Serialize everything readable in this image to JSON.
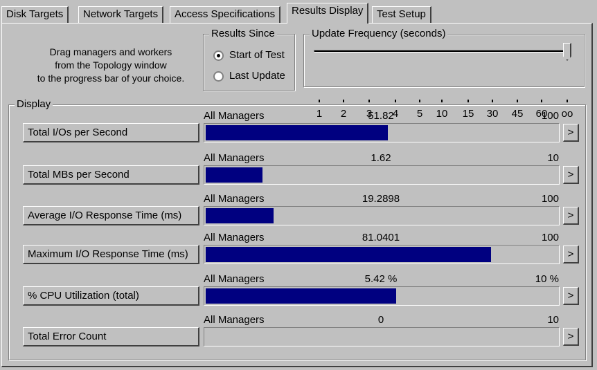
{
  "tabs": [
    {
      "label": "Disk Targets"
    },
    {
      "label": "Network Targets"
    },
    {
      "label": "Access Specifications"
    },
    {
      "label": "Results Display",
      "active": true
    },
    {
      "label": "Test Setup"
    }
  ],
  "instructions": [
    "Drag managers and workers",
    "from the Topology window",
    "to the progress bar of your choice."
  ],
  "results_since": {
    "title": "Results Since",
    "options": [
      {
        "label": "Start of Test",
        "selected": true
      },
      {
        "label": "Last Update",
        "selected": false
      }
    ]
  },
  "update_frequency": {
    "title": "Update Frequency (seconds)",
    "ticks": [
      "1",
      "2",
      "3",
      "4",
      "5",
      "10",
      "15",
      "30",
      "45",
      "60",
      "oo"
    ],
    "selected": "oo"
  },
  "display": {
    "title": "Display",
    "rows": [
      {
        "button": "Total I/Os per Second",
        "source": "All Managers",
        "value": "51.82",
        "max": "100",
        "fraction": 0.5182
      },
      {
        "button": "Total MBs per Second",
        "source": "All Managers",
        "value": "1.62",
        "max": "10",
        "fraction": 0.162
      },
      {
        "button": "Average I/O Response Time (ms)",
        "source": "All Managers",
        "value": "19.2898",
        "max": "100",
        "fraction": 0.192898
      },
      {
        "button": "Maximum I/O Response Time (ms)",
        "source": "All Managers",
        "value": "81.0401",
        "max": "100",
        "fraction": 0.810401
      },
      {
        "button": "% CPU Utilization (total)",
        "source": "All Managers",
        "value": "5.42 %",
        "max": "10 %",
        "fraction": 0.542
      },
      {
        "button": "Total Error Count",
        "source": "All Managers",
        "value": "0",
        "max": "10",
        "fraction": 0
      }
    ],
    "arrow": ">"
  },
  "colors": {
    "bar_fill": "#000080",
    "background": "#c0c0c0"
  }
}
